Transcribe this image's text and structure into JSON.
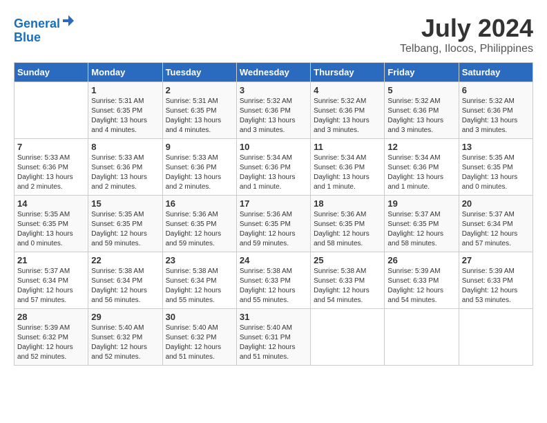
{
  "logo": {
    "line1": "General",
    "line2": "Blue"
  },
  "title": "July 2024",
  "subtitle": "Telbang, Ilocos, Philippines",
  "headers": [
    "Sunday",
    "Monday",
    "Tuesday",
    "Wednesday",
    "Thursday",
    "Friday",
    "Saturday"
  ],
  "weeks": [
    [
      {
        "num": "",
        "info": ""
      },
      {
        "num": "1",
        "info": "Sunrise: 5:31 AM\nSunset: 6:35 PM\nDaylight: 13 hours\nand 4 minutes."
      },
      {
        "num": "2",
        "info": "Sunrise: 5:31 AM\nSunset: 6:35 PM\nDaylight: 13 hours\nand 4 minutes."
      },
      {
        "num": "3",
        "info": "Sunrise: 5:32 AM\nSunset: 6:36 PM\nDaylight: 13 hours\nand 3 minutes."
      },
      {
        "num": "4",
        "info": "Sunrise: 5:32 AM\nSunset: 6:36 PM\nDaylight: 13 hours\nand 3 minutes."
      },
      {
        "num": "5",
        "info": "Sunrise: 5:32 AM\nSunset: 6:36 PM\nDaylight: 13 hours\nand 3 minutes."
      },
      {
        "num": "6",
        "info": "Sunrise: 5:32 AM\nSunset: 6:36 PM\nDaylight: 13 hours\nand 3 minutes."
      }
    ],
    [
      {
        "num": "7",
        "info": "Sunrise: 5:33 AM\nSunset: 6:36 PM\nDaylight: 13 hours\nand 2 minutes."
      },
      {
        "num": "8",
        "info": "Sunrise: 5:33 AM\nSunset: 6:36 PM\nDaylight: 13 hours\nand 2 minutes."
      },
      {
        "num": "9",
        "info": "Sunrise: 5:33 AM\nSunset: 6:36 PM\nDaylight: 13 hours\nand 2 minutes."
      },
      {
        "num": "10",
        "info": "Sunrise: 5:34 AM\nSunset: 6:36 PM\nDaylight: 13 hours\nand 1 minute."
      },
      {
        "num": "11",
        "info": "Sunrise: 5:34 AM\nSunset: 6:36 PM\nDaylight: 13 hours\nand 1 minute."
      },
      {
        "num": "12",
        "info": "Sunrise: 5:34 AM\nSunset: 6:36 PM\nDaylight: 13 hours\nand 1 minute."
      },
      {
        "num": "13",
        "info": "Sunrise: 5:35 AM\nSunset: 6:35 PM\nDaylight: 13 hours\nand 0 minutes."
      }
    ],
    [
      {
        "num": "14",
        "info": "Sunrise: 5:35 AM\nSunset: 6:35 PM\nDaylight: 13 hours\nand 0 minutes."
      },
      {
        "num": "15",
        "info": "Sunrise: 5:35 AM\nSunset: 6:35 PM\nDaylight: 12 hours\nand 59 minutes."
      },
      {
        "num": "16",
        "info": "Sunrise: 5:36 AM\nSunset: 6:35 PM\nDaylight: 12 hours\nand 59 minutes."
      },
      {
        "num": "17",
        "info": "Sunrise: 5:36 AM\nSunset: 6:35 PM\nDaylight: 12 hours\nand 59 minutes."
      },
      {
        "num": "18",
        "info": "Sunrise: 5:36 AM\nSunset: 6:35 PM\nDaylight: 12 hours\nand 58 minutes."
      },
      {
        "num": "19",
        "info": "Sunrise: 5:37 AM\nSunset: 6:35 PM\nDaylight: 12 hours\nand 58 minutes."
      },
      {
        "num": "20",
        "info": "Sunrise: 5:37 AM\nSunset: 6:34 PM\nDaylight: 12 hours\nand 57 minutes."
      }
    ],
    [
      {
        "num": "21",
        "info": "Sunrise: 5:37 AM\nSunset: 6:34 PM\nDaylight: 12 hours\nand 57 minutes."
      },
      {
        "num": "22",
        "info": "Sunrise: 5:38 AM\nSunset: 6:34 PM\nDaylight: 12 hours\nand 56 minutes."
      },
      {
        "num": "23",
        "info": "Sunrise: 5:38 AM\nSunset: 6:34 PM\nDaylight: 12 hours\nand 55 minutes."
      },
      {
        "num": "24",
        "info": "Sunrise: 5:38 AM\nSunset: 6:33 PM\nDaylight: 12 hours\nand 55 minutes."
      },
      {
        "num": "25",
        "info": "Sunrise: 5:38 AM\nSunset: 6:33 PM\nDaylight: 12 hours\nand 54 minutes."
      },
      {
        "num": "26",
        "info": "Sunrise: 5:39 AM\nSunset: 6:33 PM\nDaylight: 12 hours\nand 54 minutes."
      },
      {
        "num": "27",
        "info": "Sunrise: 5:39 AM\nSunset: 6:33 PM\nDaylight: 12 hours\nand 53 minutes."
      }
    ],
    [
      {
        "num": "28",
        "info": "Sunrise: 5:39 AM\nSunset: 6:32 PM\nDaylight: 12 hours\nand 52 minutes."
      },
      {
        "num": "29",
        "info": "Sunrise: 5:40 AM\nSunset: 6:32 PM\nDaylight: 12 hours\nand 52 minutes."
      },
      {
        "num": "30",
        "info": "Sunrise: 5:40 AM\nSunset: 6:32 PM\nDaylight: 12 hours\nand 51 minutes."
      },
      {
        "num": "31",
        "info": "Sunrise: 5:40 AM\nSunset: 6:31 PM\nDaylight: 12 hours\nand 51 minutes."
      },
      {
        "num": "",
        "info": ""
      },
      {
        "num": "",
        "info": ""
      },
      {
        "num": "",
        "info": ""
      }
    ]
  ]
}
